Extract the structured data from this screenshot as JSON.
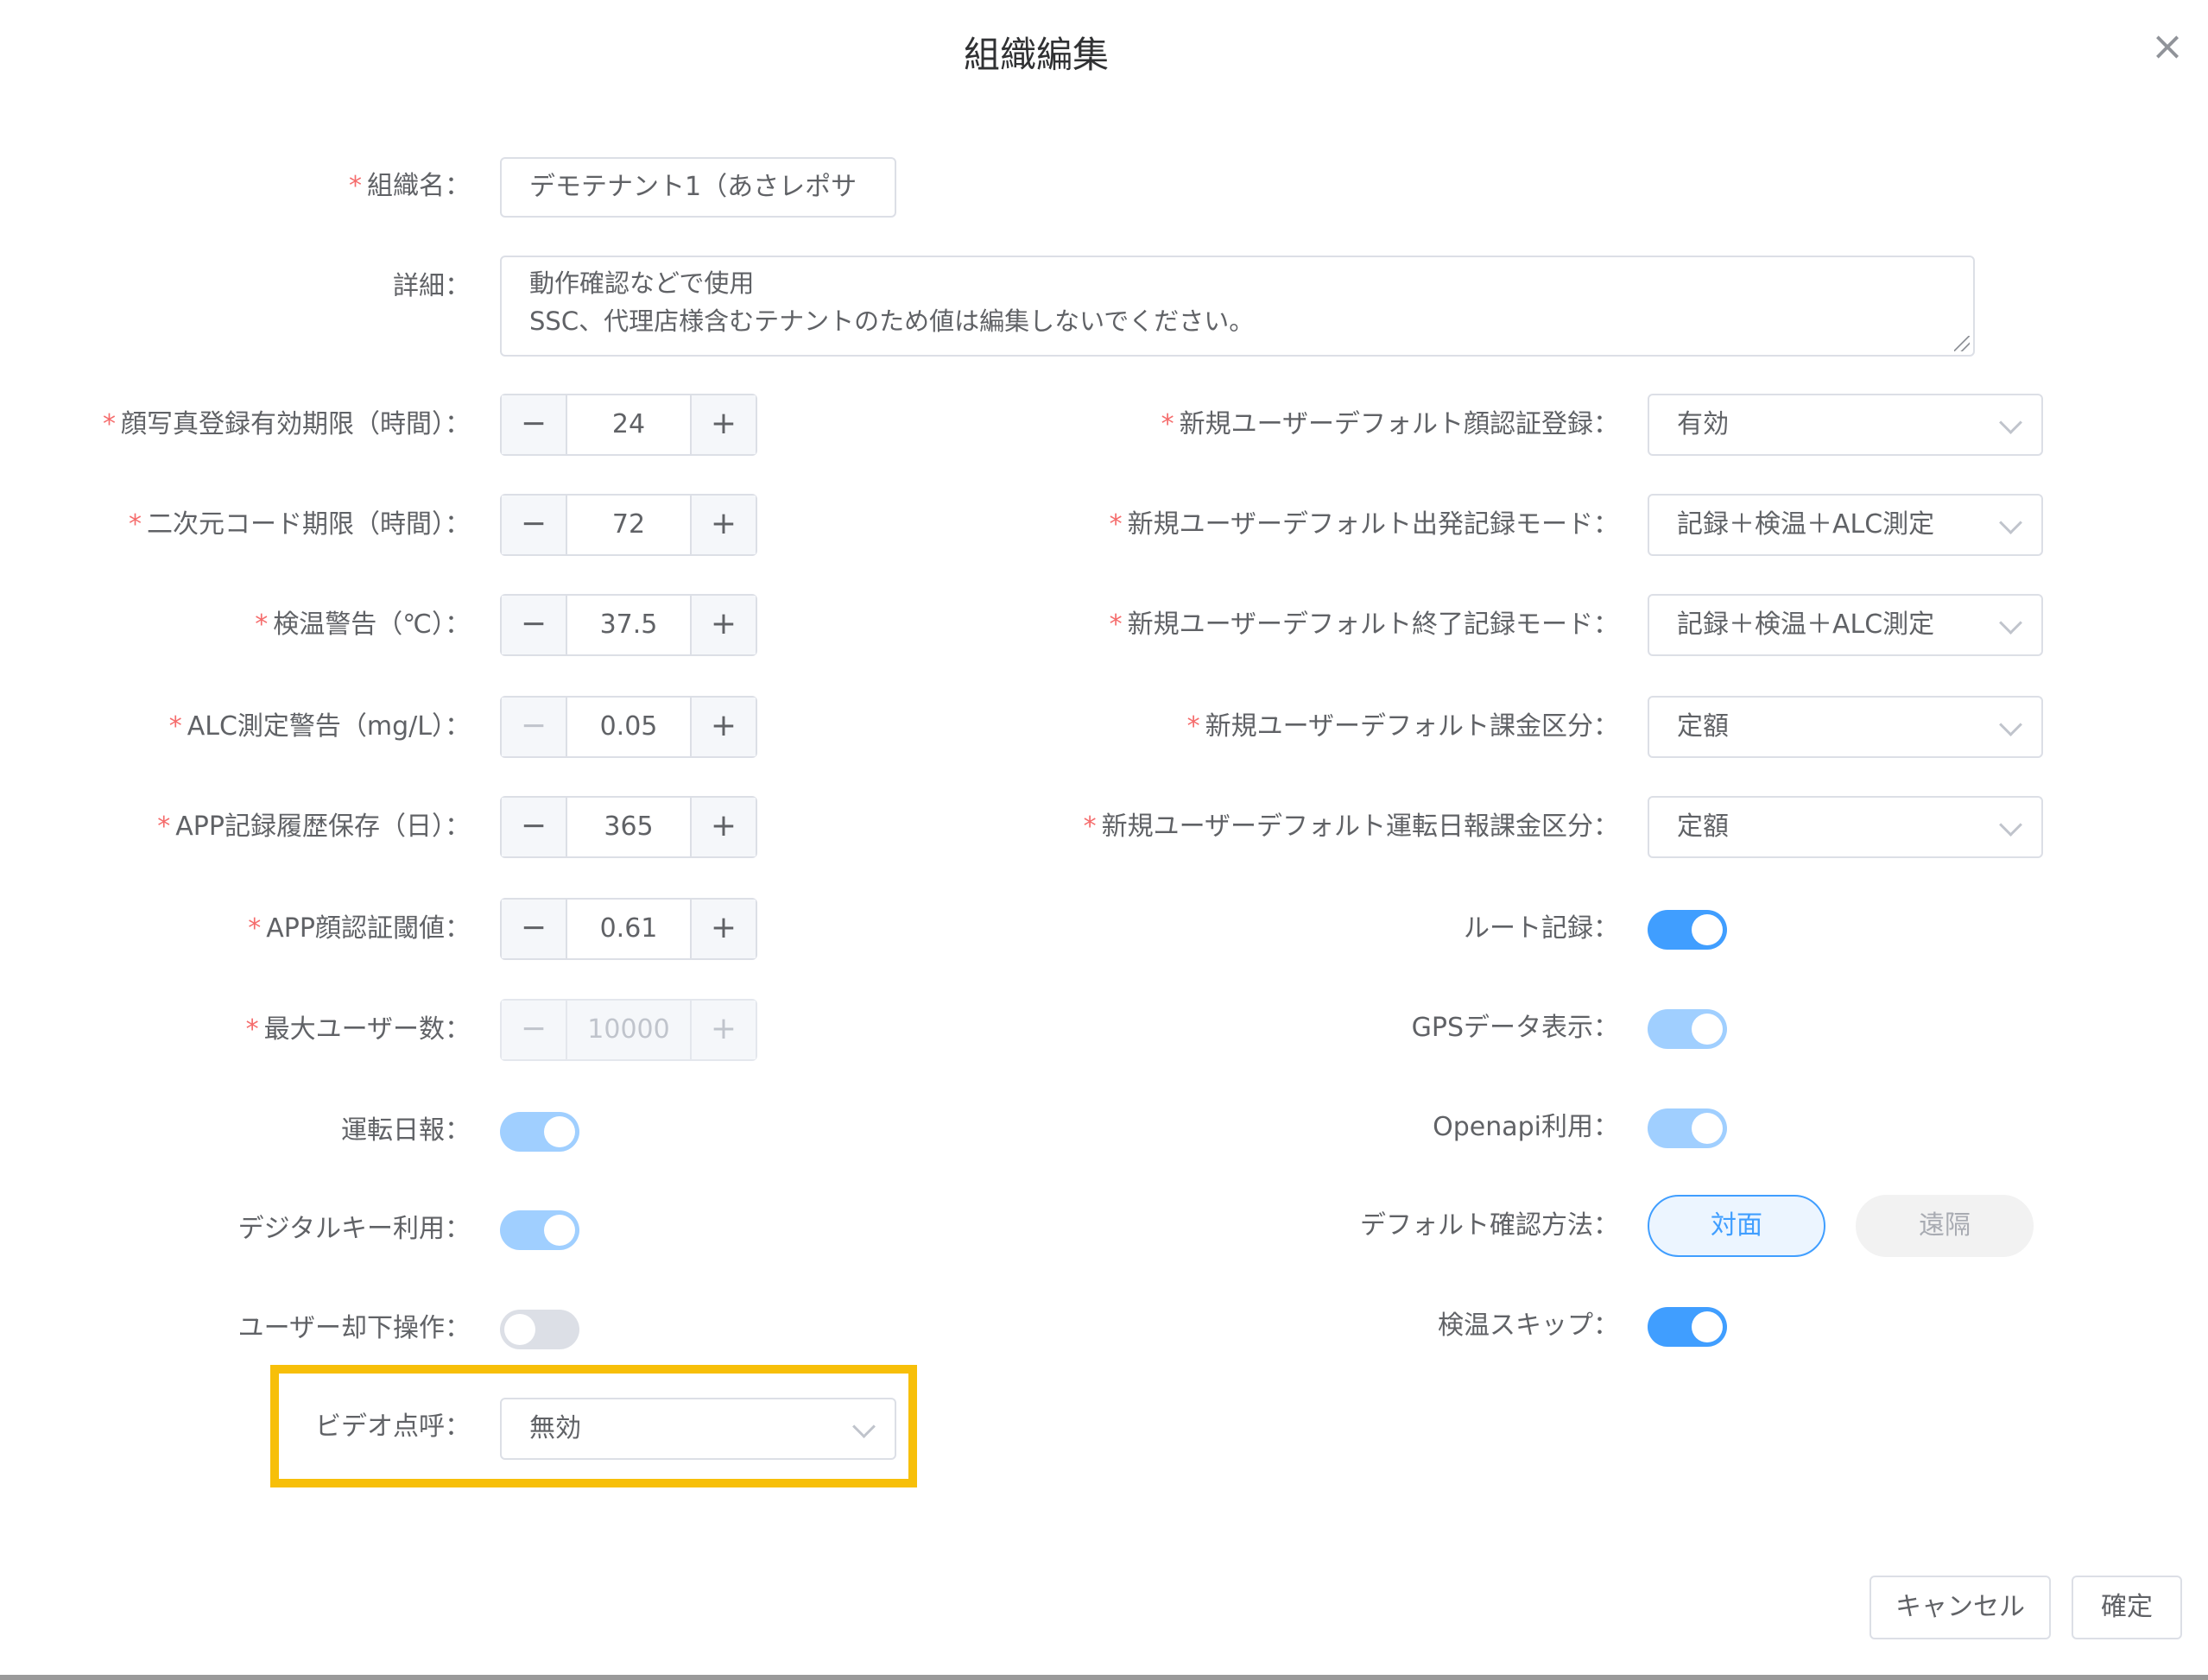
{
  "dialog": {
    "title": "組織編集",
    "close_symbol": "×"
  },
  "colors": {
    "accent": "#409eff",
    "required": "#f56c6c",
    "highlight": "#f7bf09"
  },
  "required_mark": "*",
  "left": {
    "org_name": {
      "label": "組織名：",
      "value": "デモテナント1（あさレポサ"
    },
    "details": {
      "label": "詳細：",
      "line1": "動作確認などで使用",
      "line2": "SSC、代理店様含むテナントのため値は編集しないでください。"
    },
    "photo_expiry": {
      "label": "顔写真登録有効期限（時間）：",
      "value": "24"
    },
    "qr_expiry": {
      "label": "二次元コード期限（時間）：",
      "value": "72"
    },
    "temp_warning": {
      "label": "検温警告（℃）：",
      "value": "37.5"
    },
    "alc_warning": {
      "label": "ALC測定警告（mg/L）：",
      "value": "0.05"
    },
    "app_history": {
      "label": "APP記録履歴保存（日）：",
      "value": "365"
    },
    "face_threshold": {
      "label": "APP顔認証閾値：",
      "value": "0.61"
    },
    "max_users": {
      "label": "最大ユーザー数：",
      "value": "10000"
    },
    "daily_report": {
      "label": "運転日報：",
      "on": true
    },
    "digital_key": {
      "label": "デジタルキー利用：",
      "on": true
    },
    "user_reject": {
      "label": "ユーザー却下操作：",
      "on": false
    },
    "video_rollcall": {
      "label": "ビデオ点呼：",
      "value": "無効"
    }
  },
  "right": {
    "face_reg": {
      "label": "新規ユーザーデフォルト顔認証登録：",
      "value": "有効"
    },
    "departure_mode": {
      "label": "新規ユーザーデフォルト出発記録モード：",
      "value": "記録＋検温＋ALC測定"
    },
    "end_mode": {
      "label": "新規ユーザーデフォルト終了記録モード：",
      "value": "記録＋検温＋ALC測定"
    },
    "billing": {
      "label": "新規ユーザーデフォルト課金区分：",
      "value": "定額"
    },
    "report_billing": {
      "label": "新規ユーザーデフォルト運転日報課金区分：",
      "value": "定額"
    },
    "route_record": {
      "label": "ルート記録：",
      "on": true
    },
    "gps_display": {
      "label": "GPSデータ表示：",
      "on": true
    },
    "openapi": {
      "label": "Openapi利用：",
      "on": true
    },
    "confirm_method": {
      "label": "デフォルト確認方法：",
      "options": [
        "対面",
        "遠隔"
      ],
      "selected": "対面"
    },
    "temp_skip": {
      "label": "検温スキップ：",
      "on": true
    }
  },
  "stepper": {
    "minus": "−",
    "plus": "+"
  },
  "footer": {
    "cancel": "キャンセル",
    "confirm": "確定"
  }
}
